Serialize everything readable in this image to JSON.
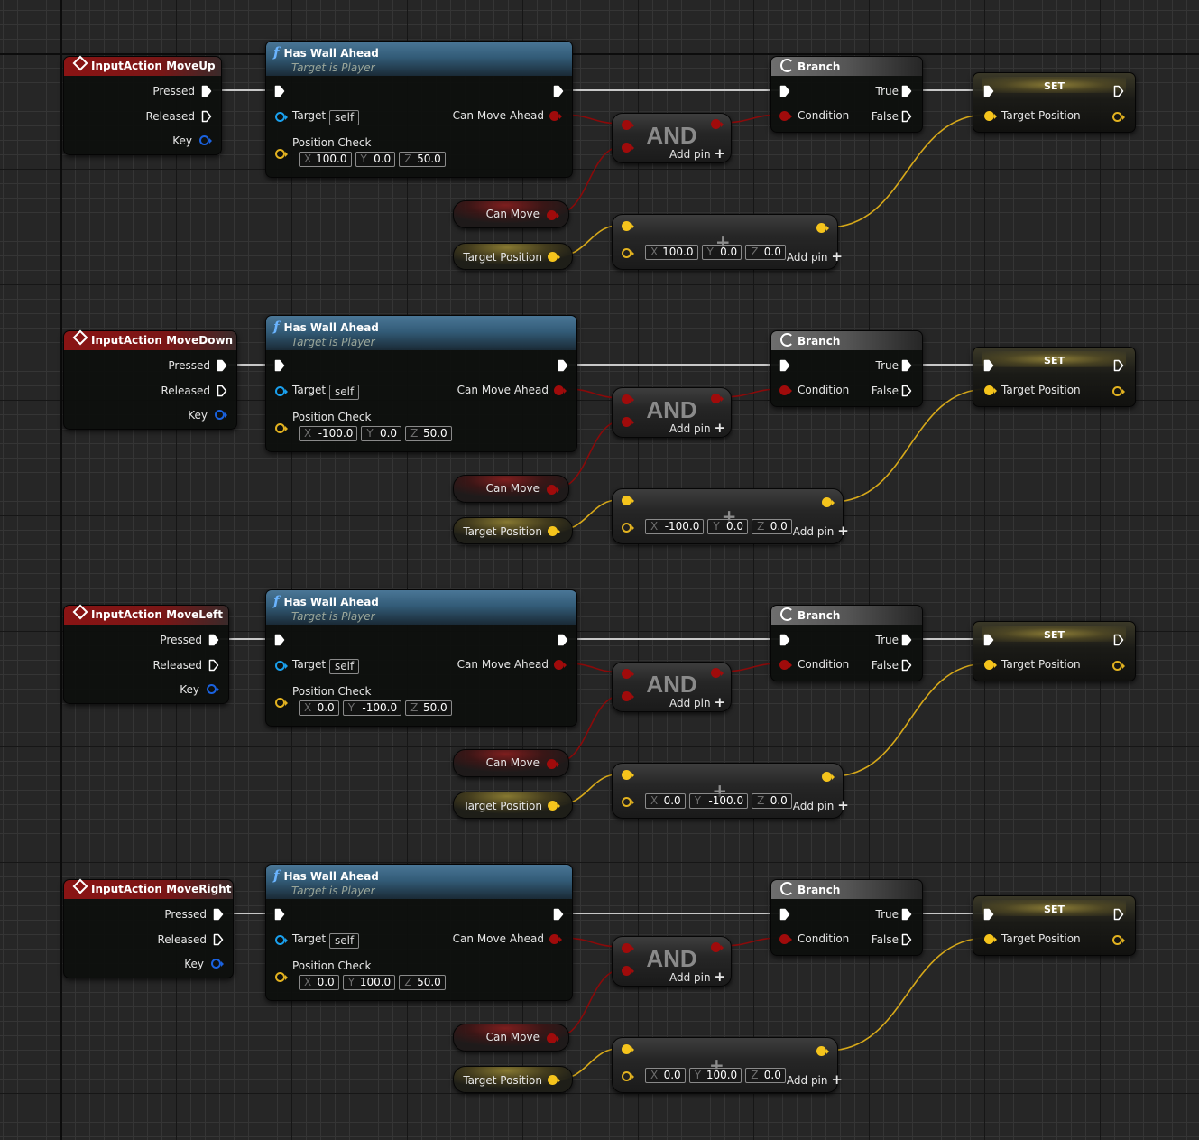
{
  "app": "Unreal Engine Blueprint Event Graph",
  "colors": {
    "exec": "#ffffff",
    "bool": "#a00b0b",
    "vector": "#f5c41c",
    "object": "#1aa0ee",
    "key": "#1a62e0",
    "event_header": "#8a1414",
    "function_header": "#4a7696",
    "branch_header": "#6e6e6e",
    "background": "#262626"
  },
  "rows": [
    {
      "event": {
        "title": "InputAction MoveUp",
        "pins": [
          "Pressed",
          "Released",
          "Key"
        ]
      },
      "function": {
        "title": "Has Wall Ahead",
        "subtitle": "Target is Player",
        "target_label": "Target",
        "target_value": "self",
        "output_label": "Can Move Ahead",
        "param_label": "Position Check",
        "x": "100.0",
        "y": "0.0",
        "z": "50.0"
      },
      "and": {
        "label": "AND",
        "add_pin": "Add pin"
      },
      "can_move": "Can Move",
      "target_position": "Target Position",
      "add": {
        "x": "100.0",
        "y": "0.0",
        "z": "0.0",
        "add_pin": "Add pin"
      },
      "branch": {
        "title": "Branch",
        "condition": "Condition",
        "true_label": "True",
        "false_label": "False"
      },
      "set": {
        "title": "SET",
        "pin": "Target Position"
      }
    },
    {
      "event": {
        "title": "InputAction MoveDown",
        "pins": [
          "Pressed",
          "Released",
          "Key"
        ]
      },
      "function": {
        "title": "Has Wall Ahead",
        "subtitle": "Target is Player",
        "target_label": "Target",
        "target_value": "self",
        "output_label": "Can Move Ahead",
        "param_label": "Position Check",
        "x": "-100.0",
        "y": "0.0",
        "z": "50.0"
      },
      "and": {
        "label": "AND",
        "add_pin": "Add pin"
      },
      "can_move": "Can Move",
      "target_position": "Target Position",
      "add": {
        "x": "-100.0",
        "y": "0.0",
        "z": "0.0",
        "add_pin": "Add pin"
      },
      "branch": {
        "title": "Branch",
        "condition": "Condition",
        "true_label": "True",
        "false_label": "False"
      },
      "set": {
        "title": "SET",
        "pin": "Target Position"
      }
    },
    {
      "event": {
        "title": "InputAction MoveLeft",
        "pins": [
          "Pressed",
          "Released",
          "Key"
        ]
      },
      "function": {
        "title": "Has Wall Ahead",
        "subtitle": "Target is Player",
        "target_label": "Target",
        "target_value": "self",
        "output_label": "Can Move Ahead",
        "param_label": "Position Check",
        "x": "0.0",
        "y": "-100.0",
        "z": "50.0"
      },
      "and": {
        "label": "AND",
        "add_pin": "Add pin"
      },
      "can_move": "Can Move",
      "target_position": "Target Position",
      "add": {
        "x": "0.0",
        "y": "-100.0",
        "z": "0.0",
        "add_pin": "Add pin"
      },
      "branch": {
        "title": "Branch",
        "condition": "Condition",
        "true_label": "True",
        "false_label": "False"
      },
      "set": {
        "title": "SET",
        "pin": "Target Position"
      }
    },
    {
      "event": {
        "title": "InputAction MoveRight",
        "pins": [
          "Pressed",
          "Released",
          "Key"
        ]
      },
      "function": {
        "title": "Has Wall Ahead",
        "subtitle": "Target is Player",
        "target_label": "Target",
        "target_value": "self",
        "output_label": "Can Move Ahead",
        "param_label": "Position Check",
        "x": "0.0",
        "y": "100.0",
        "z": "50.0"
      },
      "and": {
        "label": "AND",
        "add_pin": "Add pin"
      },
      "can_move": "Can Move",
      "target_position": "Target Position",
      "add": {
        "x": "0.0",
        "y": "100.0",
        "z": "0.0",
        "add_pin": "Add pin"
      },
      "branch": {
        "title": "Branch",
        "condition": "Condition",
        "true_label": "True",
        "false_label": "False"
      },
      "set": {
        "title": "SET",
        "pin": "Target Position"
      }
    }
  ]
}
